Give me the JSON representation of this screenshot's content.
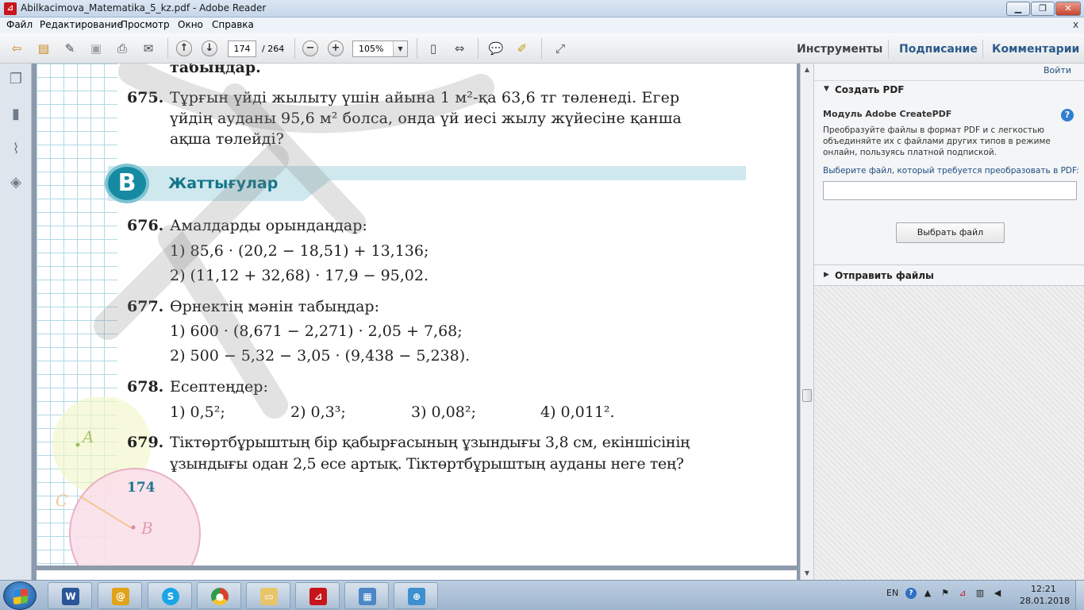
{
  "window": {
    "title": "Abilkacimova_Matematika_5_kz.pdf - Adobe Reader",
    "controls": {
      "minimize": "▁",
      "maximize": "❐",
      "close": "✕"
    }
  },
  "menu": {
    "items": [
      "Файл",
      "Редактирование",
      "Просмотр",
      "Окно",
      "Справка"
    ],
    "close_doc": "x"
  },
  "toolbar": {
    "page_current": "174",
    "page_total": "/ 264",
    "zoom": "105%",
    "pane_tabs": {
      "tools": "Инструменты",
      "sign": "Подписание",
      "comments": "Комментарии"
    }
  },
  "document": {
    "top_fragment": "табыңдар.",
    "problem_675": {
      "number": "675.",
      "line1": "Тұрғын үйді жылыту үшін айына 1 м²-қа 63,6 тг төленеді. Егер",
      "line2": "үйдің ауданы 95,6 м² болса, онда үй иесі жылу жүйесіне қанша",
      "line3": "ақша төлейді?"
    },
    "section": {
      "badge": "B",
      "title": "Жаттығулар"
    },
    "problem_676": {
      "number": "676.",
      "title": "Амалдарды орындаңдар:",
      "item1": "1) 85,6 · (20,2 − 18,51) + 13,136;",
      "item2": "2) (11,12 + 32,68) · 17,9 − 95,02."
    },
    "problem_677": {
      "number": "677.",
      "title": "Өрнектің мәнін табыңдар:",
      "item1": "1) 600 · (8,671 − 2,271) · 2,05 + 7,68;",
      "item2": "2) 500 − 5,32 − 3,05 · (9,438 − 5,238)."
    },
    "problem_678": {
      "number": "678.",
      "title": "Есептеңдер:",
      "items": [
        "1) 0,5²;",
        "2) 0,3³;",
        "3) 0,08²;",
        "4) 0,011²."
      ]
    },
    "problem_679": {
      "number": "679.",
      "line1": "Тіктөртбұрыштың бір қабырғасының ұзындығы 3,8 см, екіншісінің",
      "line2": "ұзындығы одан 2,5 есе артық. Тіктөртбұрыштың ауданы неге тең?"
    },
    "page_number": "174",
    "geometry_labels": {
      "a": "A",
      "b": "B",
      "c": "C"
    }
  },
  "right_pane": {
    "customize": "Войти",
    "create_pdf": {
      "header": "Создать PDF",
      "module_title": "Модуль Adobe CreatePDF",
      "description": "Преобразуйте файлы в формат PDF и с легкостью объединяйте их с файлами других типов в режиме онлайн, пользуясь платной подпиской.",
      "file_label": "Выберите файл, который требуется преобразовать в PDF:",
      "choose_button": "Выбрать файл"
    },
    "send_files": {
      "header": "Отправить файлы"
    }
  },
  "taskbar": {
    "apps": [
      "word-icon",
      "mail-icon",
      "skype-icon",
      "chrome-icon",
      "explorer-icon",
      "acrobat-icon",
      "control-panel-icon",
      "network-icon"
    ],
    "tray": {
      "lang": "EN",
      "time": "12:21",
      "date": "28.01.2018"
    }
  },
  "colors": {
    "accent": "#168aa0",
    "section_title": "#14758b",
    "link": "#1e4d80"
  }
}
